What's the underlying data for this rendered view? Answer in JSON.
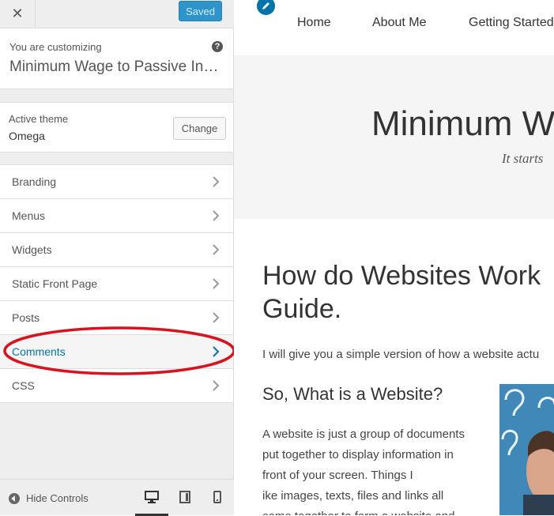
{
  "topbar": {
    "close_glyph": "✕",
    "saved_label": "Saved"
  },
  "customizing": {
    "label": "You are customizing",
    "title": "Minimum Wage to Passive Income",
    "help_glyph": "?"
  },
  "theme": {
    "label": "Active theme",
    "name": "Omega",
    "change_label": "Change"
  },
  "menu": {
    "items": [
      {
        "label": "Branding"
      },
      {
        "label": "Menus"
      },
      {
        "label": "Widgets"
      },
      {
        "label": "Static Front Page"
      },
      {
        "label": "Posts"
      },
      {
        "label": "Comments",
        "active": true
      },
      {
        "label": "CSS"
      }
    ]
  },
  "footer": {
    "hide_controls": "Hide Controls",
    "devices": [
      "desktop-icon",
      "tablet-icon",
      "mobile-icon"
    ]
  },
  "preview": {
    "nav": [
      "Home",
      "About Me",
      "Getting Started"
    ],
    "site_title": "Minimum W",
    "tagline": "It starts",
    "post_title": "How do Websites Work Guide.",
    "intro": "I will give you a simple version of how a website actu",
    "sub_heading": "So, What is a Website?",
    "para_lines": [
      "A website is just a group of documents",
      "put together to display information in",
      "front of your screen. Things I",
      "ike images, texts, files and links all",
      "come together to form a website and"
    ]
  },
  "colors": {
    "accent": "#0073aa",
    "saved_button": "#2e94c9",
    "annotation": "#d8131f"
  }
}
